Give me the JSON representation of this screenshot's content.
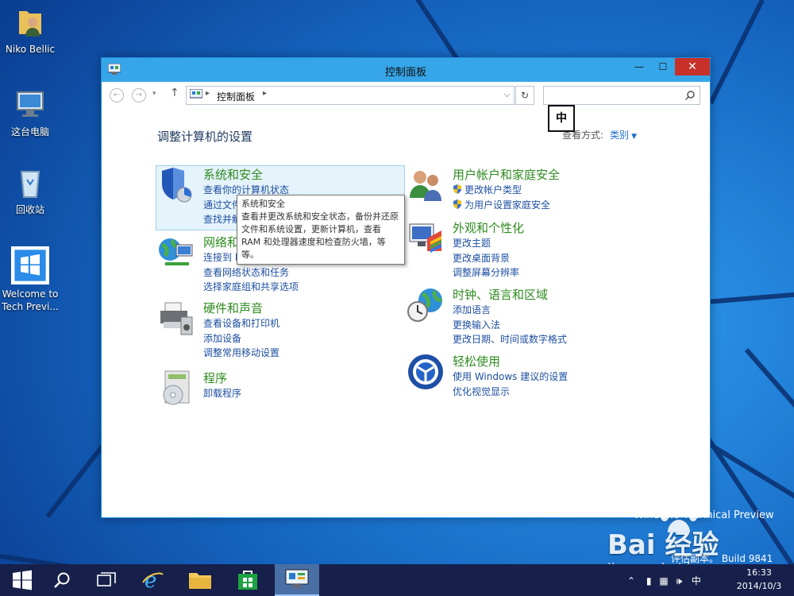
{
  "desktop": {
    "icons": [
      {
        "label": "Niko Bellic",
        "icon": "user-folder-icon"
      },
      {
        "label": "这台电脑",
        "icon": "computer-icon"
      },
      {
        "label": "回收站",
        "icon": "recycle-bin-icon"
      },
      {
        "label": "Welcome to Tech Previ...",
        "icon": "windows-welcome-icon"
      }
    ]
  },
  "window": {
    "title": "控制面板",
    "buttons": {
      "minimize": "—",
      "maximize": "☐",
      "close": "✕"
    },
    "address": {
      "breadcrumb": "控制面板",
      "search_placeholder": ""
    },
    "ime_indicator": "中",
    "heading": "调整计算机的设置",
    "view_by": {
      "label": "查看方式:",
      "value": "类别"
    },
    "categories_left": [
      {
        "title": "系统和安全",
        "icon": "shield-security-icon",
        "links": [
          "查看你的计算机状态",
          "通过文件历史记录保存你的文件备份副本",
          "查找并解决问题"
        ]
      },
      {
        "title": "网络和 Internet",
        "icon": "network-globe-icon",
        "links": [
          "连接到 Internet",
          "查看网络状态和任务",
          "选择家庭组和共享选项"
        ]
      },
      {
        "title": "硬件和声音",
        "icon": "printer-hardware-icon",
        "links": [
          "查看设备和打印机",
          "添加设备",
          "调整常用移动设置"
        ]
      },
      {
        "title": "程序",
        "icon": "programs-disc-icon",
        "links": [
          "卸载程序"
        ]
      }
    ],
    "categories_right": [
      {
        "title": "用户帐户和家庭安全",
        "icon": "users-icon",
        "links": [
          "更改帐户类型",
          "为用户设置家庭安全"
        ]
      },
      {
        "title": "外观和个性化",
        "icon": "appearance-palette-icon",
        "links": [
          "更改主题",
          "更改桌面背景",
          "调整屏幕分辨率"
        ]
      },
      {
        "title": "时钟、语言和区域",
        "icon": "clock-globe-icon",
        "links": [
          "添加语言",
          "更换输入法",
          "更改日期、时间或数字格式"
        ]
      },
      {
        "title": "轻松使用",
        "icon": "ease-of-access-icon",
        "links": [
          "使用 Windows 建议的设置",
          "优化视觉显示"
        ]
      }
    ],
    "tooltip": {
      "title": "系统和安全",
      "body": "查看并更改系统和安全状态，备份并还原文件和系统设置，更新计算机，查看 RAM 和处理器速度和检查防火墙，等等。"
    }
  },
  "watermark": {
    "line1": "Windows Technical Preview",
    "line2": "评估副本。 Build 9841",
    "logo": "Bai 经验",
    "url": "jingyan.baidu.com"
  },
  "taskbar": {
    "buttons": [
      "start-icon",
      "search-icon",
      "task-view-icon",
      "ie-icon",
      "explorer-icon",
      "store-icon",
      "control-panel-icon"
    ],
    "tray_ime": "中",
    "time": "16:33",
    "date": "2014/10/3"
  },
  "colors": {
    "category_title": "#2e8b1f",
    "link": "#1e4fa0",
    "titlebar": "#36a6e8",
    "close": "#c7312a",
    "taskbar": "#16204a"
  }
}
